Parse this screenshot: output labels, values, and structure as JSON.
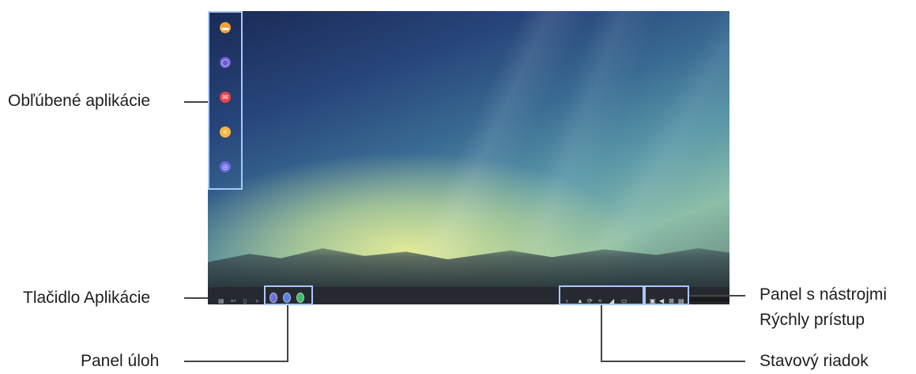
{
  "labels": {
    "favorite_apps": "Obľúbené aplikácie",
    "apps_button": "Tlačidlo Aplikácie",
    "taskbar": "Panel úloh",
    "quick_access_line1": "Panel s nástrojmi",
    "quick_access_line2": "Rýchly prístup",
    "status_bar": "Stavový riadok"
  },
  "favorites": [
    {
      "icon": "my-files-icon",
      "color": "#f4a23a",
      "glyph": "▬"
    },
    {
      "icon": "gallery-icon",
      "color": "#6b5bd6",
      "glyph": "◯"
    },
    {
      "icon": "email-icon",
      "color": "#e8474f",
      "glyph": "✉"
    },
    {
      "icon": "share-icon",
      "color": "#f5b942",
      "glyph": "<"
    },
    {
      "icon": "internet-icon",
      "color": "#6a6ae0",
      "glyph": "◎"
    }
  ],
  "taskbar_icons": [
    "apps-grid-icon",
    "back-icon",
    "recent-icon",
    "home-icon"
  ],
  "taskbar_apps": [
    {
      "icon": "app-1-icon",
      "color": "#6f6fd8"
    },
    {
      "icon": "app-2-icon",
      "color": "#5a80e0"
    },
    {
      "icon": "app-3-icon",
      "color": "#43b86a"
    }
  ],
  "status_icons": [
    "chevron-icon",
    "notification-icon",
    "sync-icon",
    "wifi-icon",
    "signal-icon",
    "battery-icon"
  ],
  "quick_access_icons": [
    "display-icon",
    "volume-icon",
    "screenshot-icon",
    "keyboard-icon"
  ]
}
